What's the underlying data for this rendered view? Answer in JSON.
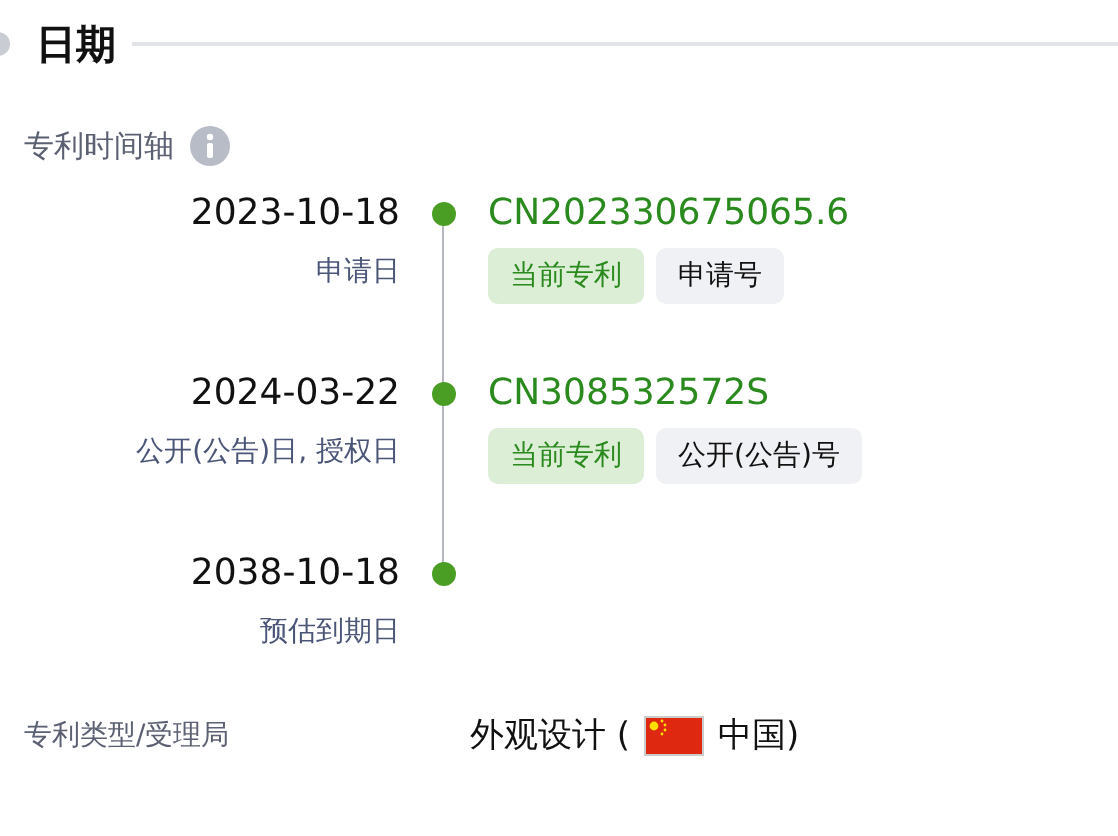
{
  "section": {
    "title": "日期"
  },
  "timeline": {
    "label": "专利时间轴",
    "events": [
      {
        "date": "2023-10-18",
        "caption": "申请日",
        "number": "CN202330675065.6",
        "tags": [
          {
            "kind": "current",
            "text": "当前专利"
          },
          {
            "kind": "type",
            "text": "申请号"
          }
        ]
      },
      {
        "date": "2024-03-22",
        "caption": "公开(公告)日, 授权日",
        "number": "CN308532572S",
        "tags": [
          {
            "kind": "current",
            "text": "当前专利"
          },
          {
            "kind": "type",
            "text": "公开(公告)号"
          }
        ]
      },
      {
        "date": "2038-10-18",
        "caption": "预估到期日"
      }
    ]
  },
  "patent_type": {
    "label": "专利类型/受理局",
    "value": "外观设计 (",
    "office": "中国)"
  }
}
